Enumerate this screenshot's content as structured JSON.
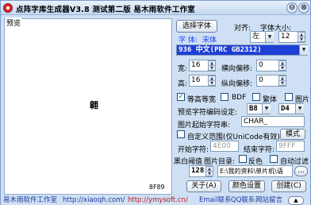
{
  "window": {
    "title": "点阵字库生成器V3.8 测试第二版 易木雨软件工作室",
    "minimize_label": "⊖",
    "close_label": "⊗"
  },
  "preview": {
    "label": "预览",
    "glyph": "翶",
    "code": "8F89"
  },
  "font": {
    "select_button": "选择字体",
    "font_prefix": "字  体:",
    "font_name": "宋体",
    "align_label": "对齐:",
    "size_label": "字体大小:",
    "align_value": "左",
    "size_value": "12",
    "charset_value": "936 中文(PRC GB2312)"
  },
  "dimensions": {
    "width_label": "宽:",
    "width_value": "16",
    "height_label": "高:",
    "height_value": "16",
    "h_offset_label": "横向偏移:",
    "h_offset_value": "0",
    "v_offset_label": "纵向偏移:",
    "v_offset_value": "0"
  },
  "options": {
    "monospace_label": "等高等宽",
    "monospace_checked": true,
    "bdf_label": "BDF",
    "bdf_checked": false,
    "traditional_label": "繁体",
    "traditional_checked": false,
    "image_label": "图片",
    "image_checked": false
  },
  "encoding": {
    "preset_label": "预览字符编码设定:",
    "byte1_value": "B8",
    "byte2_value": "D4",
    "image_start_label": "图片起始字符串:",
    "image_start_value": "CHAR_"
  },
  "custom_range": {
    "label": "自定义范围(仅UniCode有效)",
    "checked": false,
    "mode_button": "模式",
    "start_label": "开始字符:",
    "start_placeholder": "4E00",
    "end_label": "结束字符:",
    "end_placeholder": "9FFF"
  },
  "threshold": {
    "label": "黑白阈值",
    "image_dir_label": "图片目录:",
    "invert_label": "反色",
    "invert_checked": false,
    "auto_filter_label": "自动过滤",
    "auto_filter_checked": false,
    "threshold_value": "128",
    "dir_value": "E:\\我的资料\\单片机\\语",
    "browse_button": "..."
  },
  "actions": {
    "about_button": "关于(A)",
    "color_button": "颜色设置",
    "create_button": "创建(C)"
  },
  "status": {
    "studio": "易木雨软件工作室",
    "url1": "http://xiaoqh.com/",
    "url2": "http://ymysoft.cn/",
    "email_label": "Email联系",
    "qq_label": "QQ联系",
    "guestbook_label": "网站留言",
    "up_label": "▲"
  },
  "colors": {
    "accent": "#1535b4",
    "link_red": "#c0161a",
    "check_green": "#1b7a1b"
  }
}
